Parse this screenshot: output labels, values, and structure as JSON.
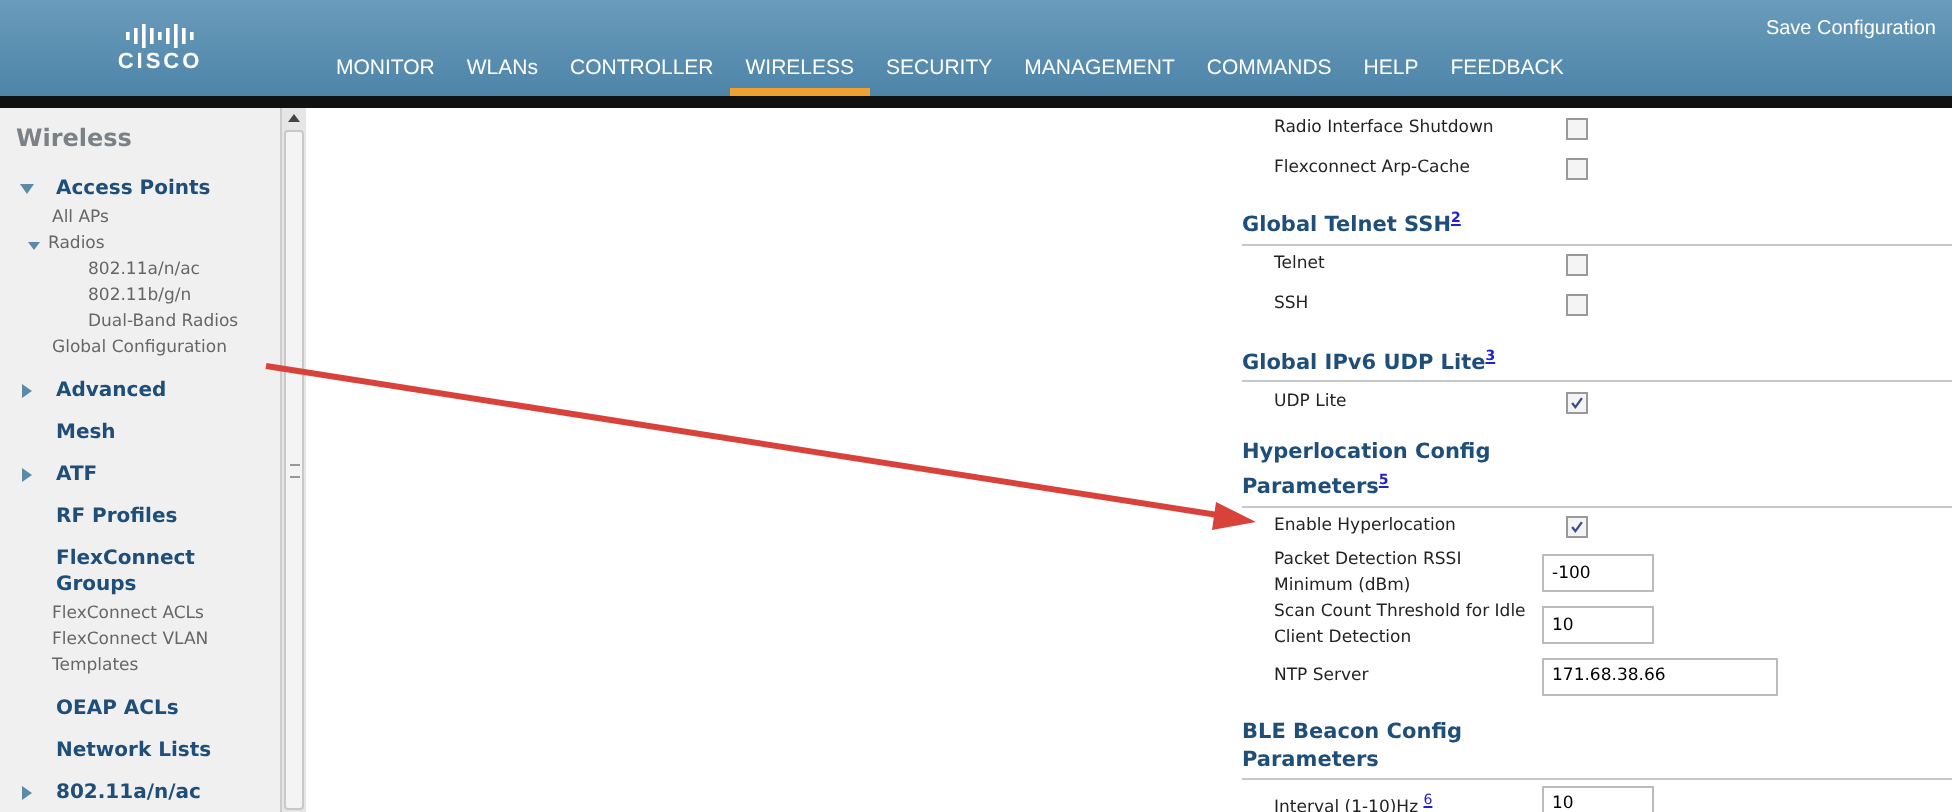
{
  "header": {
    "logo": "CISCO",
    "menu": [
      {
        "label": "MONITOR",
        "selected": false
      },
      {
        "label": "WLANs",
        "selected": false
      },
      {
        "label": "CONTROLLER",
        "selected": false
      },
      {
        "label": "WIRELESS",
        "selected": true
      },
      {
        "label": "SECURITY",
        "selected": false
      },
      {
        "label": "MANAGEMENT",
        "selected": false
      },
      {
        "label": "COMMANDS",
        "selected": false
      },
      {
        "label": "HELP",
        "selected": false
      },
      {
        "label": "FEEDBACK",
        "selected": false
      }
    ],
    "save": {
      "label": "Save Configuration"
    }
  },
  "sidebar": {
    "title": "Wireless",
    "items": [
      {
        "label": "Access Points",
        "expanded": true,
        "children": [
          {
            "label": "All APs"
          },
          {
            "label": "Radios",
            "expanded": true,
            "children": [
              {
                "label": "802.11a/n/ac"
              },
              {
                "label": "802.11b/g/n"
              },
              {
                "label": "Dual-Band Radios"
              }
            ]
          },
          {
            "label": "Global Configuration"
          }
        ]
      },
      {
        "label": "Advanced",
        "expanded": false
      },
      {
        "label": "Mesh"
      },
      {
        "label": "ATF",
        "expanded": false
      },
      {
        "label": "RF Profiles"
      },
      {
        "label": "FlexConnect Groups",
        "children": [
          {
            "label": "FlexConnect ACLs"
          },
          {
            "label": "FlexConnect VLAN Templates"
          }
        ]
      },
      {
        "label": "OEAP ACLs"
      },
      {
        "label": "Network Lists"
      },
      {
        "label": "802.11a/n/ac",
        "expanded": false
      }
    ]
  },
  "panel": {
    "sections": [
      {
        "fields": [
          {
            "kind": "checkbox",
            "label": "Radio Interface Shutdown",
            "checked": false
          },
          {
            "kind": "checkbox",
            "label": "Flexconnect Arp-Cache",
            "checked": false
          }
        ]
      },
      {
        "title": "Global Telnet SSH$^{2}$",
        "fields": [
          {
            "kind": "checkbox",
            "label": "Telnet",
            "checked": false
          },
          {
            "kind": "checkbox",
            "label": "SSH",
            "checked": false
          }
        ]
      },
      {
        "title": "Global IPv6 UDP Lite$^{3}$",
        "fields": [
          {
            "kind": "checkbox",
            "label": "UDP Lite",
            "checked": true
          }
        ]
      },
      {
        "title": "Hyperlocation Config Parameters$^{5}$",
        "fields": [
          {
            "kind": "checkbox",
            "label": "Enable Hyperlocation",
            "checked": true
          },
          {
            "kind": "text",
            "label": "Packet Detection RSSI Minimum (dBm)",
            "value": "-100"
          },
          {
            "kind": "text",
            "label": "Scan Count Threshold for Idle Client Detection",
            "value": "10"
          },
          {
            "kind": "wide-text",
            "label": "NTP Server",
            "value": "171.68.38.66"
          }
        ]
      },
      {
        "title": "BLE Beacon Config Parameters",
        "fields": [
          {
            "kind": "text",
            "label": "Interval (1-10)Hz $^{6}$",
            "value": "10"
          }
        ]
      }
    ]
  }
}
